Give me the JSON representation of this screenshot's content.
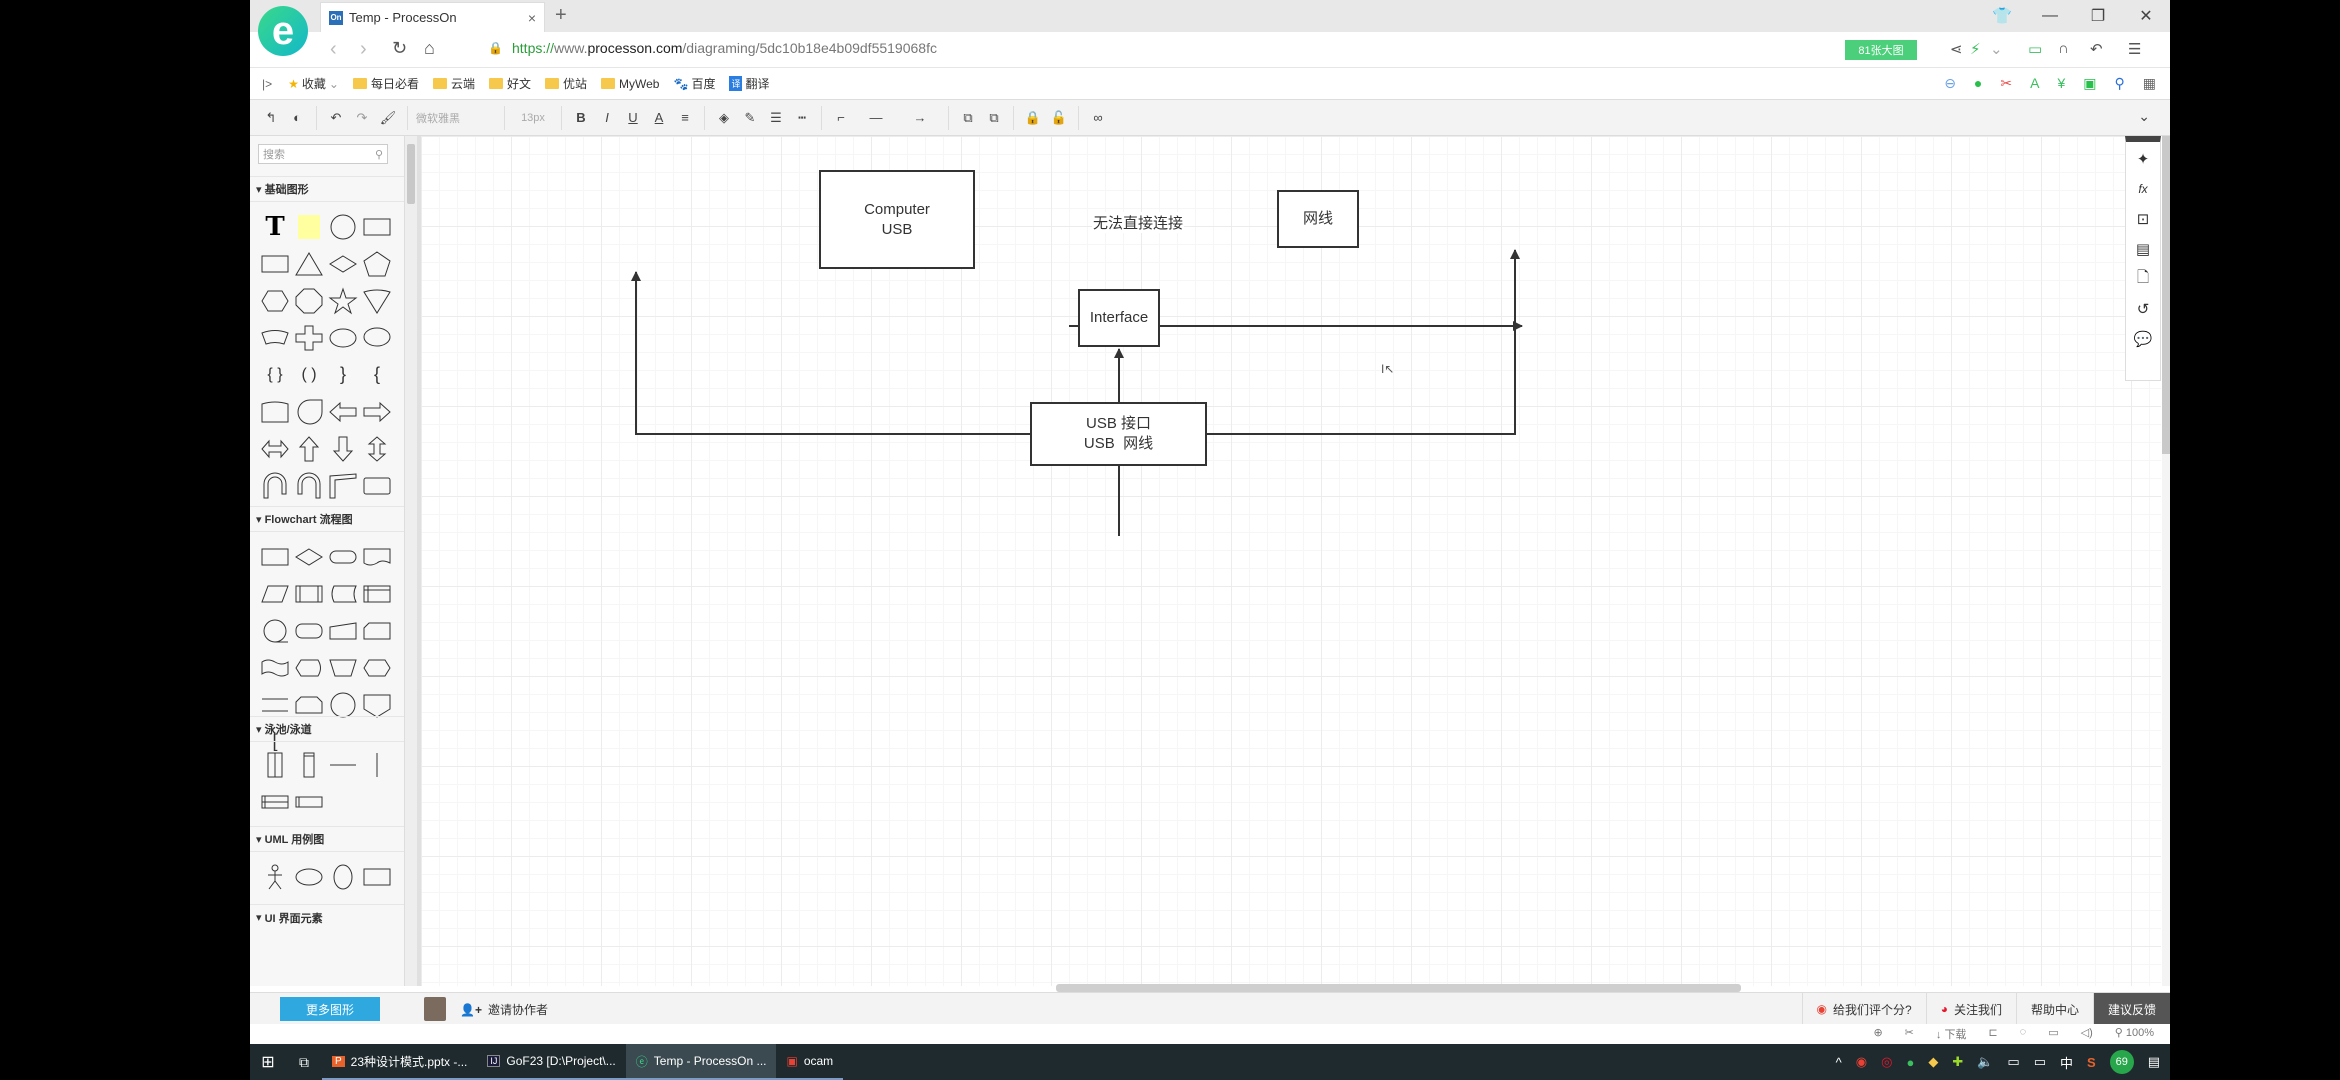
{
  "browser": {
    "tab": {
      "favicon": "On",
      "title": "Temp - ProcessOn",
      "close": "×"
    },
    "new_tab": "+",
    "window_controls": [
      "skin-icon",
      "minimize",
      "restore",
      "close"
    ],
    "url": {
      "scheme": "https://",
      "host_prefix": "www.",
      "domain": "processon.com",
      "path": "/diagraming/5dc10b18e4b09df5519068fc"
    },
    "big_picture_button": "81张大图",
    "bookmarks": [
      {
        "label": "收藏",
        "icon": "star-icon"
      },
      {
        "label": "每日必看",
        "icon": "folder-icon"
      },
      {
        "label": "云端",
        "icon": "folder-icon"
      },
      {
        "label": "好文",
        "icon": "folder-icon"
      },
      {
        "label": "优站",
        "icon": "folder-icon"
      },
      {
        "label": "MyWeb",
        "icon": "folder-icon"
      },
      {
        "label": "百度",
        "icon": "baidu-icon"
      },
      {
        "label": "翻译",
        "icon": "translate-icon"
      }
    ]
  },
  "toolbar": {
    "font_family": "微软雅黑",
    "font_size": "13px",
    "bold": "B",
    "italic": "I",
    "underline": "U",
    "font_color": "A"
  },
  "sidebar": {
    "search_placeholder": "搜索",
    "sections": [
      {
        "title": "基础图形"
      },
      {
        "title": "Flowchart 流程图"
      },
      {
        "title": "泳池/泳道"
      },
      {
        "title": "UML 用例图"
      },
      {
        "title": "UI 界面元素"
      }
    ],
    "more_shapes": "更多图形"
  },
  "diagram": {
    "nodes": [
      {
        "id": "computer",
        "lines": [
          "Computer",
          "USB"
        ]
      },
      {
        "id": "cable",
        "lines": [
          "网线"
        ]
      },
      {
        "id": "interface",
        "lines": [
          "Interface"
        ]
      },
      {
        "id": "adapter",
        "lines": [
          "USB 接口",
          "USB  网线"
        ]
      }
    ],
    "edges": [
      {
        "from": "computer",
        "to": "cable",
        "label": "无法直接连接"
      },
      {
        "from": "adapter",
        "to": "interface",
        "label": ""
      },
      {
        "from": "adapter",
        "to": "computer",
        "label": ""
      },
      {
        "from": "adapter",
        "to": "cable",
        "label": ""
      }
    ]
  },
  "bottom": {
    "invite": "邀请协作者",
    "rate": "给我们评个分?",
    "follow": "关注我们",
    "help": "帮助中心",
    "feedback": "建议反馈"
  },
  "statusbar": {
    "download": "下载",
    "zoom": "100%"
  },
  "taskbar": {
    "items": [
      {
        "label": "23种设计模式.pptx -...",
        "icon": "powerpoint-icon",
        "active": false
      },
      {
        "label": "GoF23 [D:\\Project\\...",
        "icon": "intellij-icon",
        "active": false
      },
      {
        "label": "Temp - ProcessOn ...",
        "icon": "browser-icon",
        "active": true
      },
      {
        "label": "ocam",
        "icon": "ocam-icon",
        "active": false
      }
    ],
    "tray": {
      "ime": "中",
      "badge": "69"
    }
  }
}
